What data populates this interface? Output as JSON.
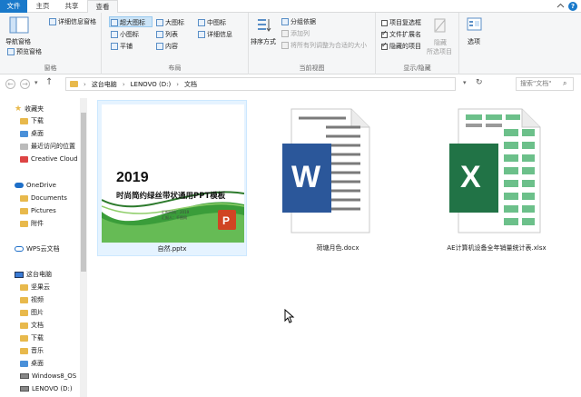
{
  "tabs": [
    {
      "label": "文件"
    },
    {
      "label": "主页"
    },
    {
      "label": "共享"
    },
    {
      "label": "查看"
    }
  ],
  "ribbon": {
    "pane": {
      "nav_pane": "导航窗格",
      "preview_pane": "预览窗格",
      "details_pane": "详细信息窗格",
      "group_label": "窗格"
    },
    "layout": {
      "items": [
        "超大图标",
        "大图标",
        "中图标",
        "小图标",
        "列表",
        "详细信息",
        "平铺",
        "内容"
      ],
      "group_label": "布局"
    },
    "current_view": {
      "sort_by": "排序方式",
      "group_by": "分组依据",
      "add_columns": "添加列",
      "fit_columns": "将所有列调整为合适的大小",
      "group_label": "当前视图"
    },
    "show_hide": {
      "item_checkboxes": "项目复选框",
      "file_extensions": "文件扩展名",
      "hidden_items": "隐藏的项目",
      "hide_selected_1": "隐藏",
      "hide_selected_2": "所选项目",
      "group_label": "显示/隐藏"
    },
    "options": "选项"
  },
  "address": {
    "breadcrumbs": [
      "这台电脑",
      "LENOVO (D:)",
      "文档"
    ],
    "search_placeholder": "搜索\"文档\""
  },
  "nav": {
    "quick_access": "收藏夹",
    "quick_items": [
      "下载",
      "桌面",
      "最近访问的位置",
      "Creative Cloud"
    ],
    "onedrive": "OneDrive",
    "onedrive_items": [
      "Documents",
      "Pictures",
      "附件"
    ],
    "wps": "WPS云文档",
    "this_pc": "这台电脑",
    "pc_items": [
      "坚果云",
      "视频",
      "图片",
      "文档",
      "下载",
      "音乐",
      "桌面",
      "Windows8_OS",
      "LENOVO (D:)"
    ]
  },
  "files": [
    {
      "name": "自然.pptx",
      "thumb_year": "2019",
      "thumb_title": "时尚简约绿丝带状通用PPT模板",
      "thumb_reporter": "汇报时间：2019",
      "thumb_person": "汇报人：千图网"
    },
    {
      "name": "荷塘月色.docx",
      "icon_letter": "W"
    },
    {
      "name": "AE计算机设备全年销量统计表.xlsx",
      "icon_letter": "X"
    }
  ],
  "colors": {
    "accent": "#1979ca",
    "word": "#2b579a",
    "excel": "#217346",
    "ppt_green": "#3a9d3a"
  }
}
